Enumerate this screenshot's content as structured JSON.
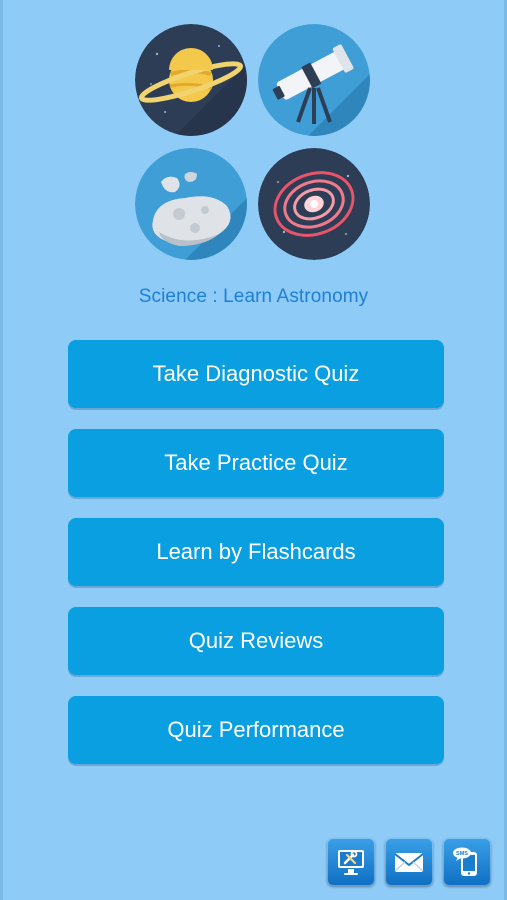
{
  "app": {
    "title": "Science : Learn Astronomy"
  },
  "logo": {
    "icons": [
      "planet-icon",
      "telescope-icon",
      "asteroid-icon",
      "galaxy-icon"
    ]
  },
  "menu": {
    "items": [
      {
        "label": "Take Diagnostic Quiz"
      },
      {
        "label": "Take Practice Quiz"
      },
      {
        "label": "Learn by Flashcards"
      },
      {
        "label": "Quiz Reviews"
      },
      {
        "label": "Quiz Performance"
      }
    ]
  },
  "toolbar": {
    "icons": [
      "settings-monitor-icon",
      "email-icon",
      "sms-phone-icon"
    ],
    "sms_badge": "SMS"
  },
  "colors": {
    "background": "#8ecbf6",
    "button": "#0a9fe0",
    "title_text": "#1e7fd6"
  }
}
